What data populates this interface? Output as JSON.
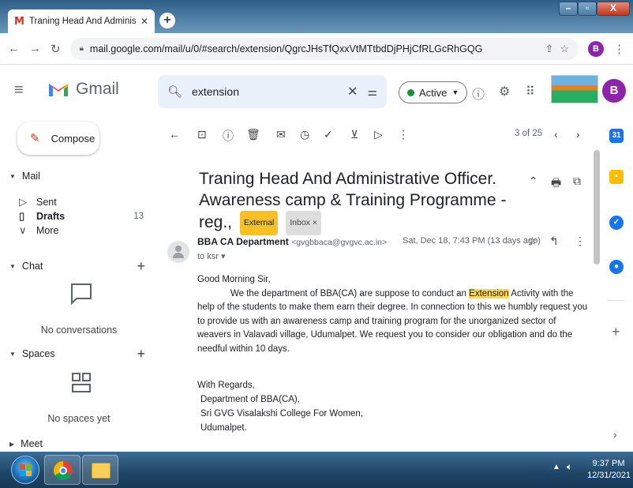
{
  "browser": {
    "tab_title": "Traning Head And Administrative",
    "tab_gmail_glyph": "M",
    "newtab_glyph": "+",
    "url": "mail.google.com/mail/u/0/#search/extension/QgrcJHsTfQxxVtMTtbdDjPHjCfRLGcRhGQG",
    "profile_initial": "B"
  },
  "header": {
    "app_name": "Gmail",
    "search_value": "extension",
    "status_label": "Active",
    "account_initial": "B"
  },
  "nav": {
    "compose_label": "Compose",
    "mail_section": "Mail",
    "items": [
      {
        "label": "Sent",
        "count": ""
      },
      {
        "label": "Drafts",
        "count": "13"
      },
      {
        "label": "More",
        "count": ""
      }
    ],
    "chat_section": "Chat",
    "chat_empty": "No conversations",
    "spaces_section": "Spaces",
    "spaces_empty": "No spaces yet",
    "meet_section": "Meet"
  },
  "toolbar": {
    "pager": "3 of 25"
  },
  "message": {
    "subject": "Traning Head And Administrative Officer. Awareness camp & Training Programme - reg.,",
    "badge_external": "External",
    "badge_inbox": "Inbox ×",
    "sender_name": "BBA CA Department",
    "sender_email": "<gvgbbaca@gvgvc.ac.in>",
    "to": "to ksr ▾",
    "date": "Sat, Dec 18, 7:43 PM (13 days ago)",
    "greeting": "Good Morning Sir,",
    "body_part1": "We the department of BBA(CA) are suppose to conduct  an",
    "body_highlight": "Extension",
    "body_part2": "Activity with the help of the students to make them earn their degree. In connection to this we humbly request you to provide us with an awareness camp and training program for the unorganized sector of  weavers in Valavadi village, Udumalpet. We request you to consider our obligation and do the needful within 10 days.",
    "signature": [
      "With Regards,",
      "Department of BBA(CA),",
      "Sri GVG Visalakshi College For Women,",
      "Udumalpet."
    ]
  },
  "taskbar": {
    "time": "9:37 PM",
    "date": "12/31/2021"
  },
  "colors": {
    "gmail_red": "#d93025",
    "active_green": "#1e8e3e",
    "external_badge": "#f6c026",
    "highlight": "#fcd655",
    "account_purple": "#8e24aa"
  }
}
